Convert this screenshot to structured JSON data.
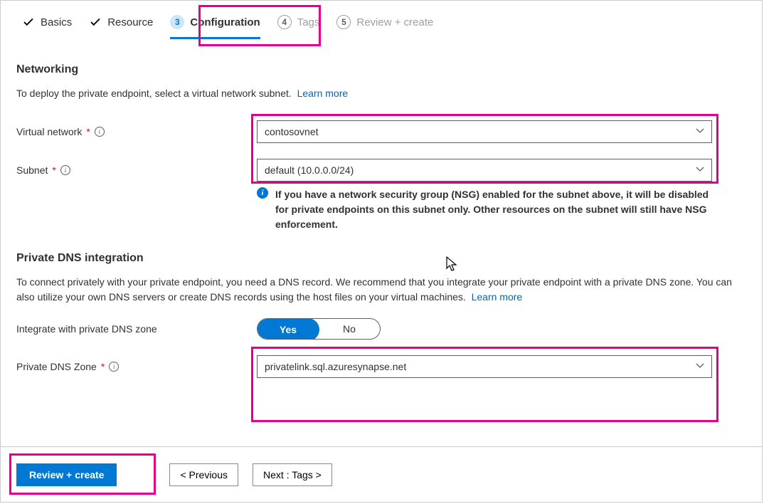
{
  "tabs": {
    "basics": {
      "label": "Basics"
    },
    "resource": {
      "label": "Resource"
    },
    "config": {
      "num": "3",
      "label": "Configuration"
    },
    "tags": {
      "num": "4",
      "label": "Tags"
    },
    "review": {
      "num": "5",
      "label": "Review + create"
    }
  },
  "networking": {
    "heading": "Networking",
    "lead": "To deploy the private endpoint, select a virtual network subnet.",
    "learn_more": "Learn more",
    "vnet_label": "Virtual network",
    "vnet_value": "contosovnet",
    "subnet_label": "Subnet",
    "subnet_value": "default (10.0.0.0/24)",
    "nsg_info": "If you have a network security group (NSG) enabled for the subnet above, it will be disabled for private endpoints on this subnet only. Other resources on the subnet will still have NSG enforcement."
  },
  "dns": {
    "heading": "Private DNS integration",
    "lead": "To connect privately with your private endpoint, you need a DNS record. We recommend that you integrate your private endpoint with a private DNS zone. You can also utilize your own DNS servers or create DNS records using the host files on your virtual machines.",
    "learn_more": "Learn more",
    "integrate_label": "Integrate with private DNS zone",
    "toggle_yes": "Yes",
    "toggle_no": "No",
    "zone_label": "Private DNS Zone",
    "zone_value": "privatelink.sql.azuresynapse.net"
  },
  "footer": {
    "review": "Review + create",
    "prev": "< Previous",
    "next": "Next : Tags >"
  }
}
